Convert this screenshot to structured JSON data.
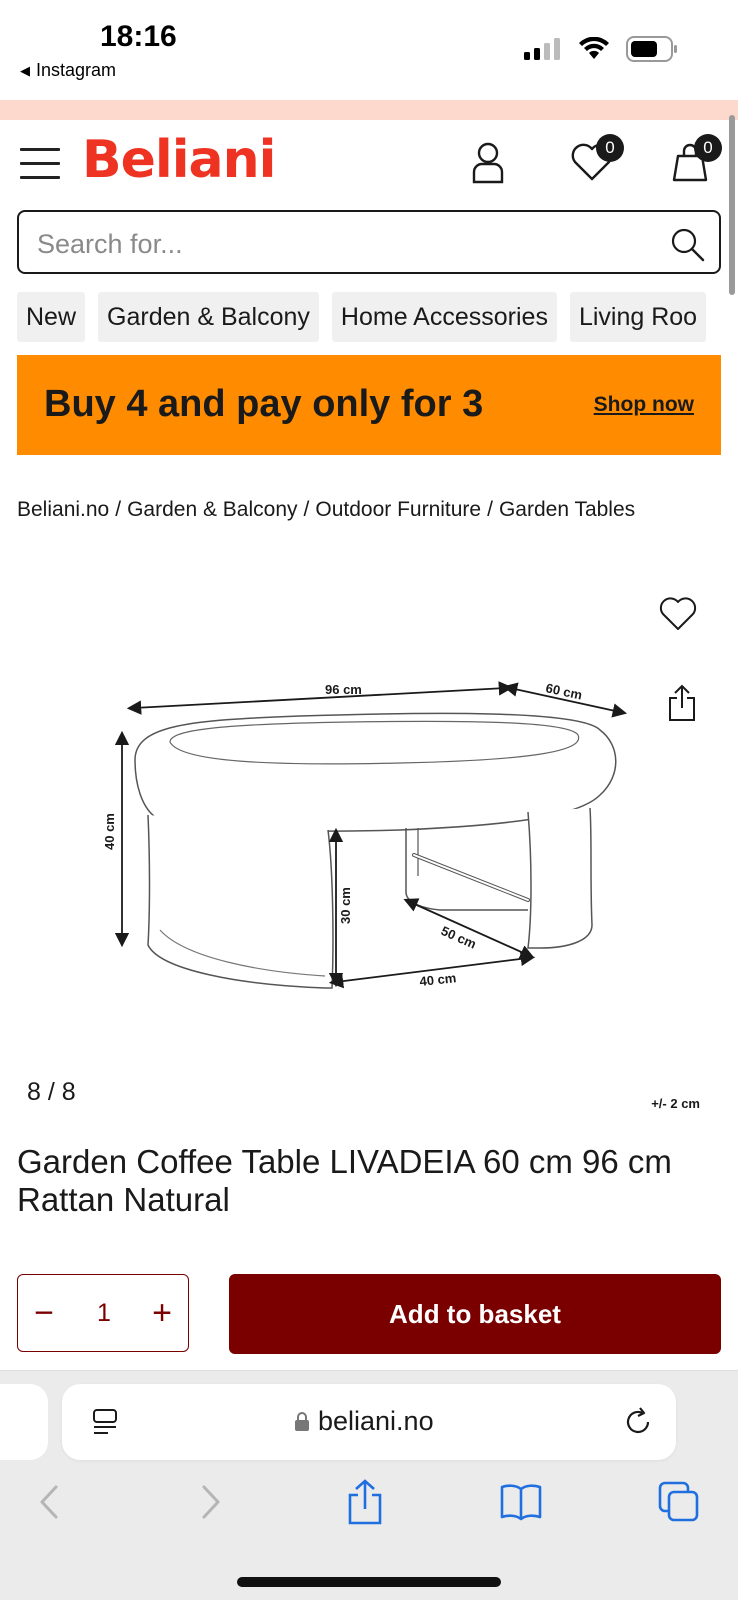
{
  "status": {
    "time": "18:16",
    "back_app": "Instagram"
  },
  "header": {
    "logo": "Beliani",
    "wishlist_count": "0",
    "cart_count": "0"
  },
  "search": {
    "placeholder": "Search for..."
  },
  "categories": [
    "New",
    "Garden & Balcony",
    "Home Accessories",
    "Living Roo"
  ],
  "banner": {
    "text": "Buy 4 and pay only for 3",
    "link": "Shop now",
    "color": "#ff8c00"
  },
  "breadcrumb": [
    "Beliani.no",
    "Garden & Balcony",
    "Outdoor Furniture",
    "Garden Tables"
  ],
  "image": {
    "dims": {
      "length": "96 cm",
      "depth": "60 cm",
      "height": "40 cm",
      "inner_height": "30 cm",
      "inner_depth": "50 cm",
      "inner_width": "40 cm"
    },
    "counter": "8 / 8",
    "tolerance": "+/- 2 cm"
  },
  "product": {
    "title": "Garden Coffee Table LIVADEIA 60 cm 96 cm Rattan Natural",
    "quantity": "1",
    "add_to_basket": "Add to basket",
    "accent_color": "#7a0000"
  },
  "browser": {
    "url": "beliani.no"
  }
}
